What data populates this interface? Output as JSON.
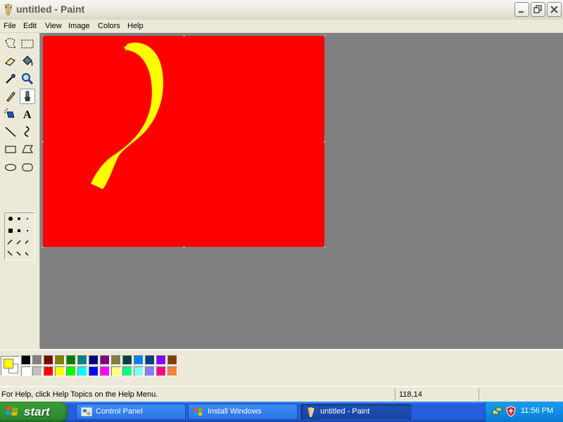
{
  "window": {
    "title": "untitled - Paint",
    "controls": [
      "minimize",
      "maximize",
      "close"
    ]
  },
  "menu": [
    "File",
    "Edit",
    "View",
    "Image",
    "Colors",
    "Help"
  ],
  "toolbox": {
    "tools": [
      "free-form-select",
      "select",
      "eraser",
      "fill-with-color",
      "pick-color",
      "magnifier",
      "pencil",
      "brush",
      "airbrush",
      "text",
      "line",
      "curve",
      "rectangle",
      "polygon",
      "ellipse",
      "rounded-rectangle"
    ],
    "selected_tool": "brush"
  },
  "canvas": {
    "background_color": "#FF0000",
    "stroke_color": "#FFFF00"
  },
  "palette": {
    "foreground": "#FFFF00",
    "background": "#FFFFFF",
    "colors_top": [
      "#000000",
      "#808080",
      "#800000",
      "#808000",
      "#008000",
      "#008080",
      "#000080",
      "#800080",
      "#808040",
      "#004040",
      "#0080FF",
      "#004080",
      "#8000FF",
      "#804000"
    ],
    "colors_bottom": [
      "#FFFFFF",
      "#C0C0C0",
      "#FF0000",
      "#FFFF00",
      "#00FF00",
      "#00FFFF",
      "#0000FF",
      "#FF00FF",
      "#FFFF80",
      "#00FF80",
      "#80FFFF",
      "#8080FF",
      "#FF0080",
      "#FF8040"
    ]
  },
  "status": {
    "help_text": "For Help, click Help Topics on the Help Menu.",
    "coords": "118,14"
  },
  "taskbar": {
    "start_label": "start",
    "tasks": [
      {
        "label": "Control Panel",
        "icon": "control-panel-icon"
      },
      {
        "label": "Install Windows",
        "icon": "windows-flag-icon"
      },
      {
        "label": "untitled - Paint",
        "icon": "paint-icon",
        "active": true
      }
    ],
    "clock": "11:56 PM"
  }
}
